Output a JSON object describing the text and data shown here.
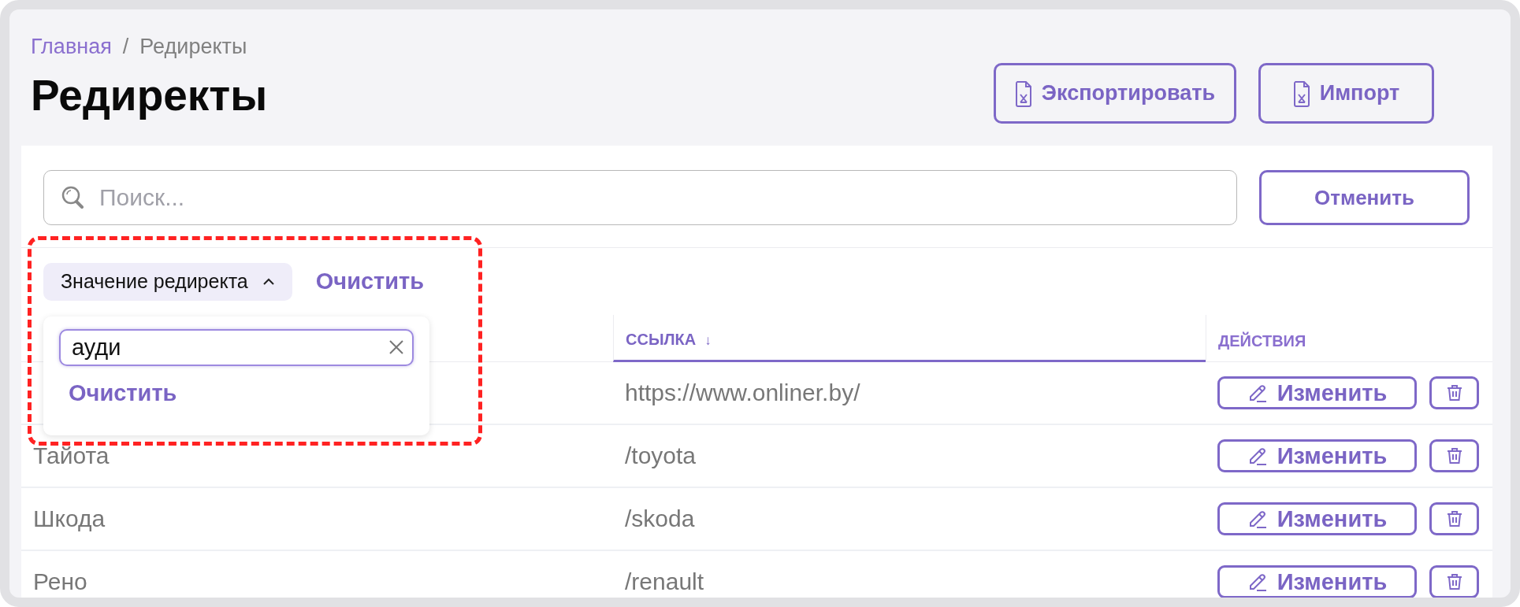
{
  "breadcrumb": [
    {
      "label": "Главная",
      "kind": "link"
    },
    {
      "label": "/",
      "kind": "separator"
    },
    {
      "label": "Редиректы",
      "kind": "current"
    }
  ],
  "title": "Редиректы",
  "header_buttons": [
    {
      "label": "Экспортировать"
    },
    {
      "label": "Импорт"
    }
  ],
  "search": {
    "placeholder": "Поиск..."
  },
  "cancel_button": "Отменить",
  "filters": [
    {
      "label": "Значение редиректа",
      "expanded": true
    }
  ],
  "clear_filters": "Очистить",
  "filter_popover": {
    "value": "ауди",
    "clear": "Очистить"
  },
  "table": {
    "columns": [
      {
        "label": "ССЫЛКА",
        "sort_mark": "↓",
        "sorted": true
      },
      {
        "label": "ДЕЙСТВИЯ",
        "sorted": false
      }
    ],
    "rows": [
      {
        "link": "https://www.onliner.by/",
        "edit": "Изменить"
      },
      {
        "name": "Тайота",
        "link": "/toyota",
        "edit": "Изменить"
      },
      {
        "name": "Шкода",
        "link": "/skoda",
        "edit": "Изменить"
      },
      {
        "name": "Рено",
        "link": "/renault",
        "edit": "Изменить"
      }
    ]
  }
}
